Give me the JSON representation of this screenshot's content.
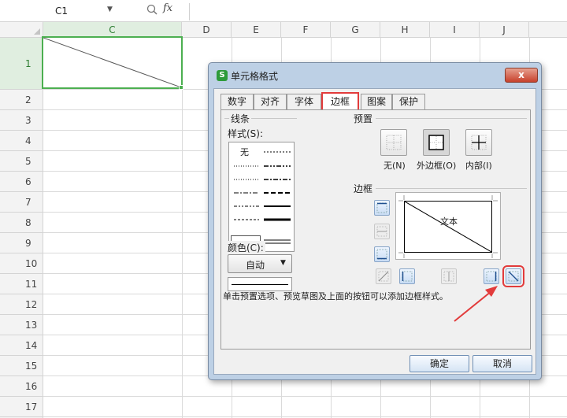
{
  "formula_bar": {
    "cell_ref": "C1",
    "fx_label": "fx"
  },
  "columns": [
    "C",
    "D",
    "E",
    "F",
    "G",
    "H",
    "I",
    "J"
  ],
  "rows": [
    "1",
    "2",
    "3",
    "4",
    "5",
    "6",
    "7",
    "8",
    "9",
    "10",
    "11",
    "12",
    "13",
    "14",
    "15",
    "16",
    "17"
  ],
  "dialog": {
    "title": "单元格格式",
    "close_label": "x",
    "tabs": [
      {
        "label": "数字"
      },
      {
        "label": "对齐"
      },
      {
        "label": "字体"
      },
      {
        "label": "边框"
      },
      {
        "label": "图案"
      },
      {
        "label": "保护"
      }
    ],
    "line_group_label": "线条",
    "style_label": "样式(S):",
    "style_none": "无",
    "color_label": "颜色(C):",
    "color_value": "自动",
    "presets_label": "预置",
    "presets": [
      {
        "label": "无(N)"
      },
      {
        "label": "外边框(O)"
      },
      {
        "label": "内部(I)"
      }
    ],
    "border_label": "边框",
    "preview_text": "文本",
    "hint": "单击预置选项、预览草图及上面的按钮可以添加边框样式。",
    "ok_label": "确定",
    "cancel_label": "取消"
  },
  "colors": {
    "selection": "#4caf50",
    "highlight": "#e23b3b",
    "dialog_frame": "#bdd0e5"
  }
}
